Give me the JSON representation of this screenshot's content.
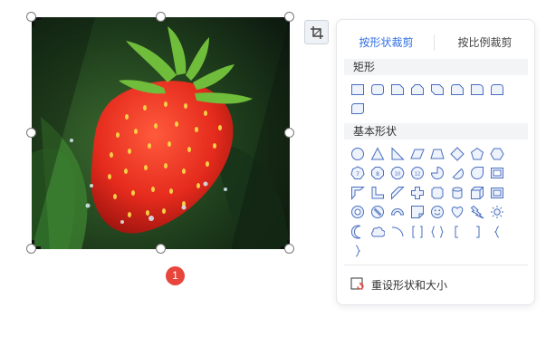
{
  "badge": {
    "number": "1"
  },
  "panel": {
    "tabs": [
      {
        "label": "按形状裁剪",
        "active": true
      },
      {
        "label": "按比例裁剪",
        "active": false
      }
    ],
    "sections": {
      "rect": {
        "title": "矩形"
      },
      "basic": {
        "title": "基本形状"
      }
    },
    "reset_label": "重设形状和大小"
  },
  "colors": {
    "accent": "#2f6fe6",
    "shape_stroke": "#4a6fbf",
    "shape_fill": "#edf2fb",
    "badge": "#e8453c"
  }
}
